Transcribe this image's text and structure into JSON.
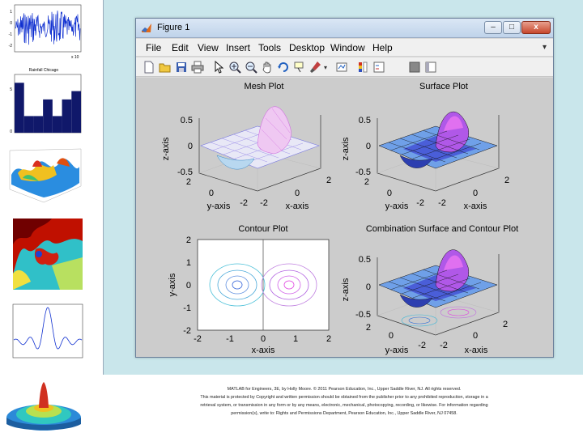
{
  "window": {
    "title": "Figure 1",
    "controls": {
      "minimize": "–",
      "maximize": "□",
      "close": "x"
    }
  },
  "menu": [
    "File",
    "Edit",
    "View",
    "Insert",
    "Tools",
    "Desktop",
    "Window",
    "Help"
  ],
  "toolbar_icons": [
    "new-figure-icon",
    "open-file-icon",
    "save-icon",
    "print-icon",
    "edit-plot-arrow-icon",
    "zoom-in-icon",
    "zoom-out-icon",
    "pan-hand-icon",
    "rotate-3d-icon",
    "data-cursor-icon",
    "brush-icon",
    "link-plot-icon",
    "insert-colorbar-icon",
    "insert-legend-icon",
    "hide-plot-tools-icon",
    "show-plot-tools-icon"
  ],
  "subplots": {
    "mesh": {
      "title": "Mesh Plot",
      "zlabel": "z-axis",
      "ylabel": "y-axis",
      "xlabel": "x-axis",
      "zticks": [
        "0.5",
        "0",
        "-0.5"
      ],
      "yticks": [
        "2",
        "0",
        "-2"
      ],
      "xticks": [
        "-2",
        "0",
        "2"
      ]
    },
    "surface": {
      "title": "Surface Plot",
      "zlabel": "z-axis",
      "ylabel": "y-axis",
      "xlabel": "x-axis",
      "zticks": [
        "0.5",
        "0",
        "-0.5"
      ],
      "yticks": [
        "2",
        "0",
        "-2"
      ],
      "xticks": [
        "-2",
        "0",
        "2"
      ]
    },
    "contour": {
      "title": "Contour Plot",
      "ylabel": "y-axis",
      "xlabel": "x-axis",
      "yticks": [
        "2",
        "1",
        "0",
        "-1",
        "-2"
      ],
      "xticks": [
        "-2",
        "-1",
        "0",
        "1",
        "2"
      ]
    },
    "combo": {
      "title": "Combination Surface and Contour Plot",
      "zlabel": "z-axis",
      "ylabel": "y-axis",
      "xlabel": "x-axis",
      "zticks": [
        "0.5",
        "0",
        "-0.5"
      ],
      "yticks": [
        "2",
        "0",
        "-2"
      ],
      "xticks": [
        "-2",
        "0",
        "2"
      ]
    }
  },
  "thumbnails": {
    "signal_tick_values": [
      "1",
      "0",
      "-1",
      "-2"
    ],
    "signal_exponent": "x 10",
    "bar_title": "Rainfall Chicago",
    "bar_values": [
      6,
      2,
      2,
      4,
      2,
      4,
      5
    ],
    "bar_yticks": [
      "5",
      "0"
    ]
  },
  "caption": {
    "line1": "MATLAB for Engineers, 3E, by Holly Moore. © 2011 Pearson Education, Inc., Upper Saddle River, NJ. All rights reserved.",
    "line2": "This material is protected by Copyright and written permission should be obtained from the publisher prior to any prohibited reproduction, storage in a",
    "line3": "retrieval system, or transmission in any form or by any means, electronic, mechanical, photocopying, recording, or likewise. For information regarding",
    "line4": "permission(s), write to: Rights and Permissions Department, Pearson Education, Inc., Upper Saddle River, NJ 07458."
  },
  "colors": {
    "teal_panel": "#c9e6eb",
    "figure_bg": "#cccccc",
    "close_button": "#c7472c"
  }
}
